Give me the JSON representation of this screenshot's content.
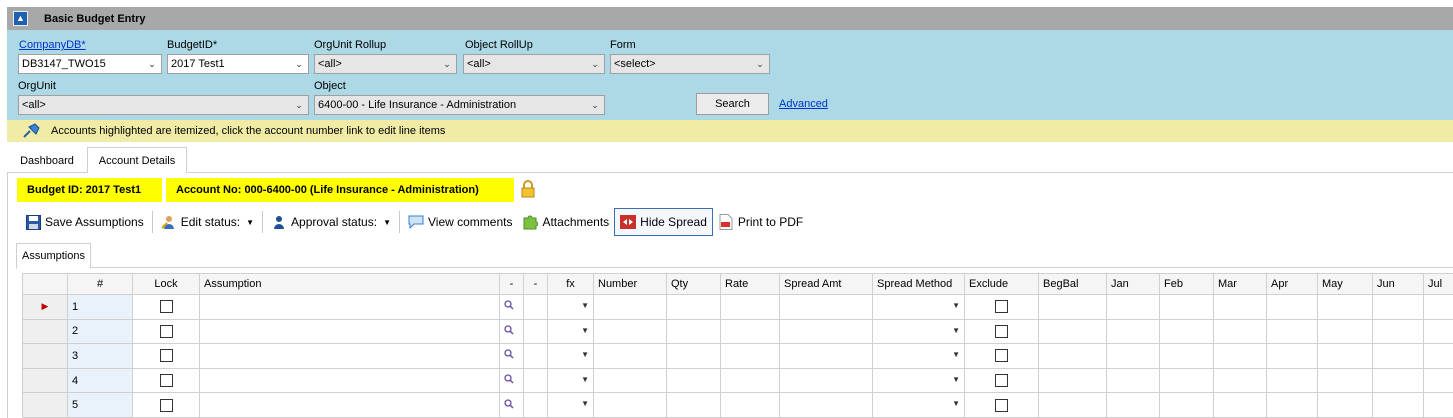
{
  "window": {
    "title": "Basic Budget Entry"
  },
  "filters": {
    "companydb": {
      "label": "CompanyDB*",
      "value": "DB3147_TWO15"
    },
    "budgetid": {
      "label": "BudgetID*",
      "value": "2017 Test1"
    },
    "orgunit_rollup": {
      "label": "OrgUnit Rollup",
      "value": "<all>"
    },
    "object_rollup": {
      "label": "Object RollUp",
      "value": "<all>"
    },
    "form": {
      "label": "Form",
      "value": "<select>"
    },
    "orgunit": {
      "label": "OrgUnit",
      "value": "<all>"
    },
    "object": {
      "label": "Object",
      "value": "6400-00 - Life Insurance - Administration"
    },
    "search_label": "Search",
    "advanced_label": "Advanced"
  },
  "info": {
    "text": "Accounts highlighted are itemized, click the account number link to edit line items"
  },
  "tabs": [
    {
      "label": "Dashboard"
    },
    {
      "label": "Account Details"
    }
  ],
  "badges": {
    "budget": "Budget ID: 2017 Test1",
    "account": "Account No: 000-6400-00 (Life Insurance - Administration)"
  },
  "toolbar": {
    "save": "Save Assumptions",
    "edit_status": "Edit status:",
    "approval_status": "Approval status:",
    "view_comments": "View comments",
    "attachments": "Attachments",
    "hide_spread": "Hide Spread",
    "print_pdf": "Print to PDF"
  },
  "subtab": {
    "label": "Assumptions"
  },
  "grid": {
    "columns": [
      "#",
      "Lock",
      "Assumption",
      "-",
      "-",
      "fx",
      "Number",
      "Qty",
      "Rate",
      "Spread Amt",
      "Spread Method",
      "Exclude",
      "BegBal",
      "Jan",
      "Feb",
      "Mar",
      "Apr",
      "May",
      "Jun",
      "Jul"
    ],
    "rows": [
      {
        "n": "1"
      },
      {
        "n": "2"
      },
      {
        "n": "3"
      },
      {
        "n": "4"
      },
      {
        "n": "5"
      }
    ]
  },
  "colors": {
    "filter_bg": "#add8e6",
    "info_bg": "#f0eca6",
    "badge_bg": "#ffff00",
    "title_bg": "#a8a8a8"
  }
}
